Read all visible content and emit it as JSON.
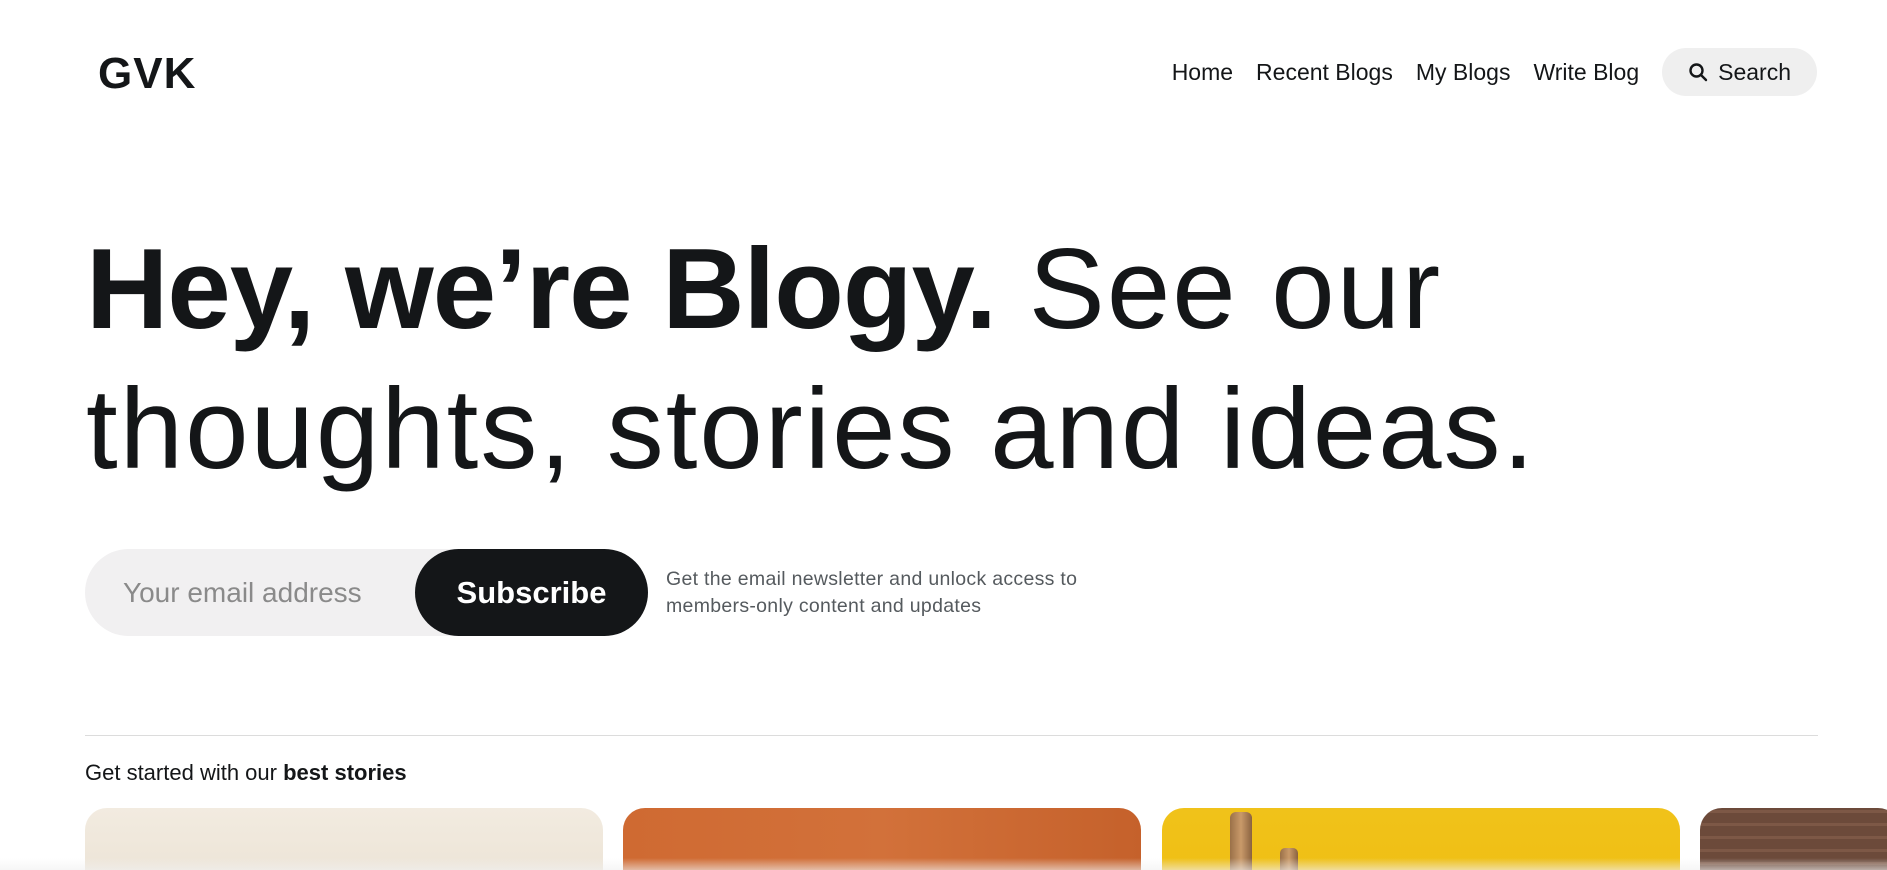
{
  "header": {
    "logo": "GVK",
    "nav": [
      {
        "label": "Home"
      },
      {
        "label": "Recent Blogs"
      },
      {
        "label": "My Blogs"
      },
      {
        "label": "Write Blog"
      }
    ],
    "search_label": "Search",
    "search_icon": "search-icon"
  },
  "hero": {
    "bold_text": "Hey, we’re Blogy.",
    "light_text_1": "See our",
    "light_text_2": "thoughts, stories and ideas."
  },
  "subscribe": {
    "placeholder": "Your email address",
    "button_label": "Subscribe",
    "note_line1": "Get the email newsletter and unlock access to",
    "note_line2": "members-only content and updates"
  },
  "stories": {
    "intro": "Get started with our",
    "intro_bold": "best stories"
  }
}
